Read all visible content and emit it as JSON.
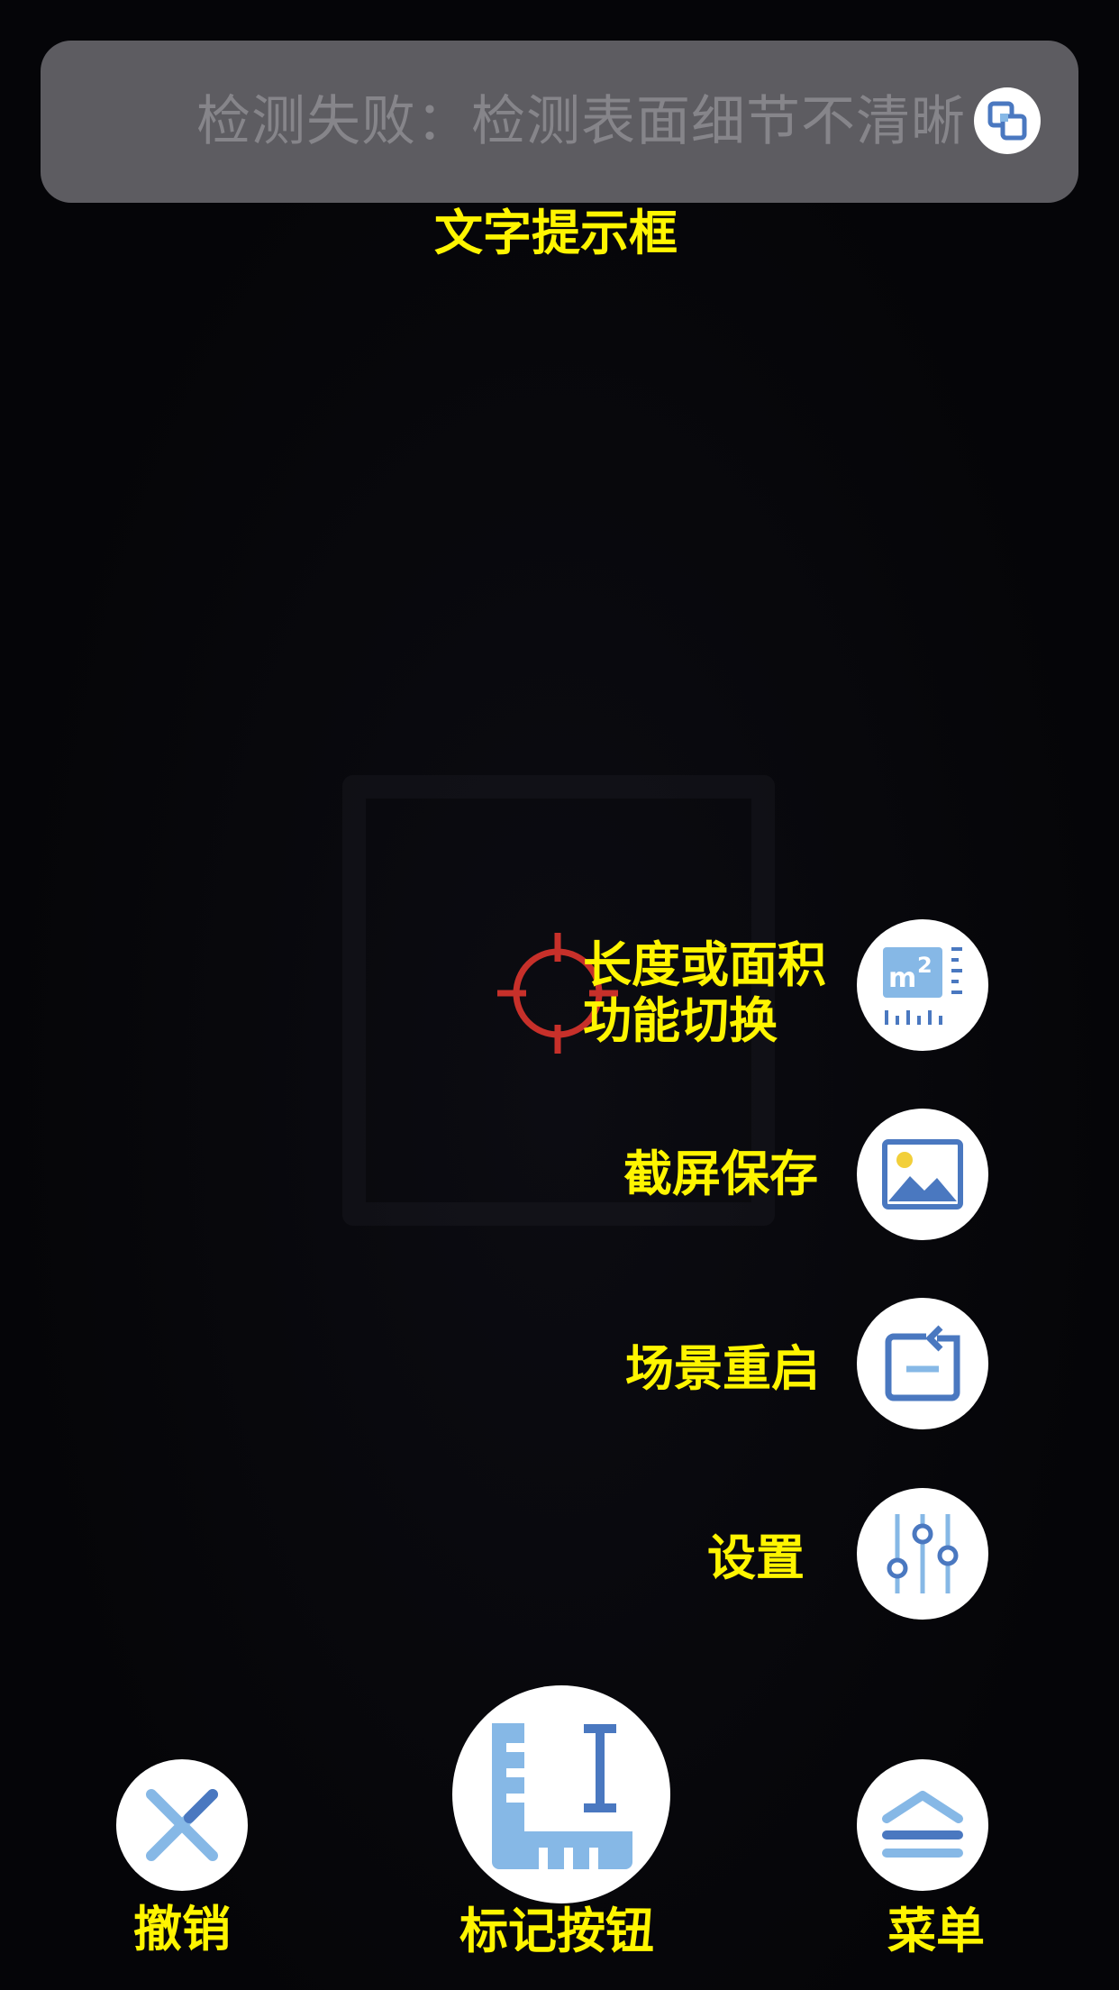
{
  "hint_bar": {
    "message": "检测失败：检测表面细节不清晰",
    "icon": "copy-icon",
    "annotation": "文字提示框"
  },
  "side_controls": [
    {
      "id": "mode-switch",
      "icon": "area-ruler-icon",
      "annotation_line1": "长度或面积",
      "annotation_line2": "功能切换"
    },
    {
      "id": "screenshot",
      "icon": "image-icon",
      "annotation": "截屏保存"
    },
    {
      "id": "restart",
      "icon": "restart-icon",
      "annotation": "场景重启"
    },
    {
      "id": "settings",
      "icon": "sliders-icon",
      "annotation": "设置"
    }
  ],
  "bottom_bar": {
    "undo": {
      "icon": "close-icon",
      "annotation": "撤销"
    },
    "mark": {
      "icon": "ruler-icon",
      "annotation": "标记按钮"
    },
    "menu": {
      "icon": "menu-icon",
      "annotation": "菜单"
    }
  },
  "colors": {
    "annotation": "#fff500",
    "icon_primary": "#4a78c0",
    "icon_light": "#86b8e6",
    "reticle": "#c7302a",
    "hint_bar_bg": "#5d5c61"
  }
}
